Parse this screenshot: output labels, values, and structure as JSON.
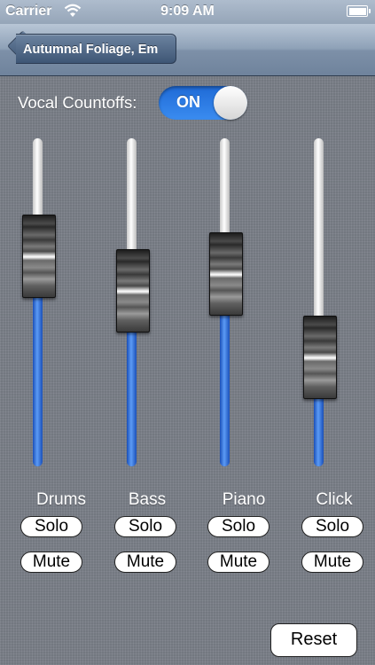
{
  "status_bar": {
    "carrier": "Carrier",
    "time": "9:09 AM"
  },
  "nav": {
    "back_label": "Autumnal Foliage, Em"
  },
  "vocal_countoffs": {
    "label": "Vocal Countoffs:",
    "state": "ON"
  },
  "channels": [
    {
      "name": "Drums",
      "solo": "Solo",
      "mute": "Mute",
      "level": 0.69
    },
    {
      "name": "Bass",
      "solo": "Solo",
      "mute": "Mute",
      "level": 0.55
    },
    {
      "name": "Piano",
      "solo": "Solo",
      "mute": "Mute",
      "level": 0.62
    },
    {
      "name": "Click",
      "solo": "Solo",
      "mute": "Mute",
      "level": 0.28
    }
  ],
  "reset_label": "Reset",
  "colors": {
    "accent": "#2f7de8",
    "track_fill": "#3d7fe6",
    "nav_bar": "#8ea1b7"
  },
  "icons": [
    "wifi-icon",
    "battery-icon",
    "back-arrow-icon"
  ]
}
